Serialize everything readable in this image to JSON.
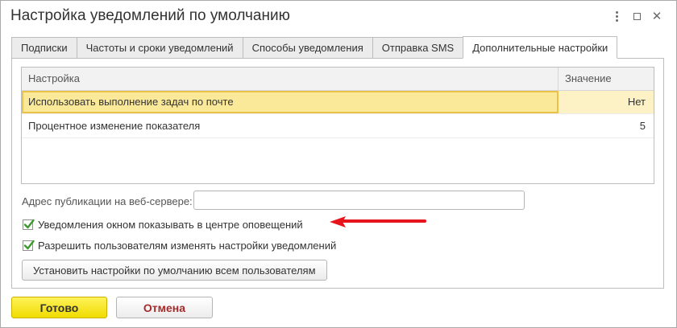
{
  "window": {
    "title": "Настройка уведомлений по умолчанию",
    "controls": [
      "kebab-menu-icon",
      "maximize-icon",
      "close-icon"
    ]
  },
  "tabs": [
    {
      "label": "Подписки",
      "active": false
    },
    {
      "label": "Частоты и сроки уведомлений",
      "active": false
    },
    {
      "label": "Способы уведомления",
      "active": false
    },
    {
      "label": "Отправка SMS",
      "active": false
    },
    {
      "label": "Дополнительные настройки",
      "active": true
    }
  ],
  "table": {
    "columns": {
      "setting": "Настройка",
      "value": "Значение"
    },
    "rows": [
      {
        "setting": "Использовать выполнение задач по почте",
        "value": "Нет",
        "selected": true
      },
      {
        "setting": "Процентное изменение показателя",
        "value": "5",
        "selected": false
      }
    ]
  },
  "publication": {
    "label": "Адрес публикации на веб-сервере:",
    "value": ""
  },
  "checkboxes": [
    {
      "label": "Уведомления окном показывать в центре оповещений",
      "checked": true
    },
    {
      "label": "Разрешить пользователям изменять настройки уведомлений",
      "checked": true
    }
  ],
  "set_defaults_button": "Установить настройки по умолчанию всем пользователям",
  "footer": {
    "ok_label": "Готово",
    "cancel_label": "Отмена"
  },
  "colors": {
    "accent_yellow": "#f0dc00",
    "selection": "#fbe99a",
    "check_green": "#3d9a2e",
    "arrow_red": "#e8141b",
    "cancel_text": "#a52a2a"
  }
}
